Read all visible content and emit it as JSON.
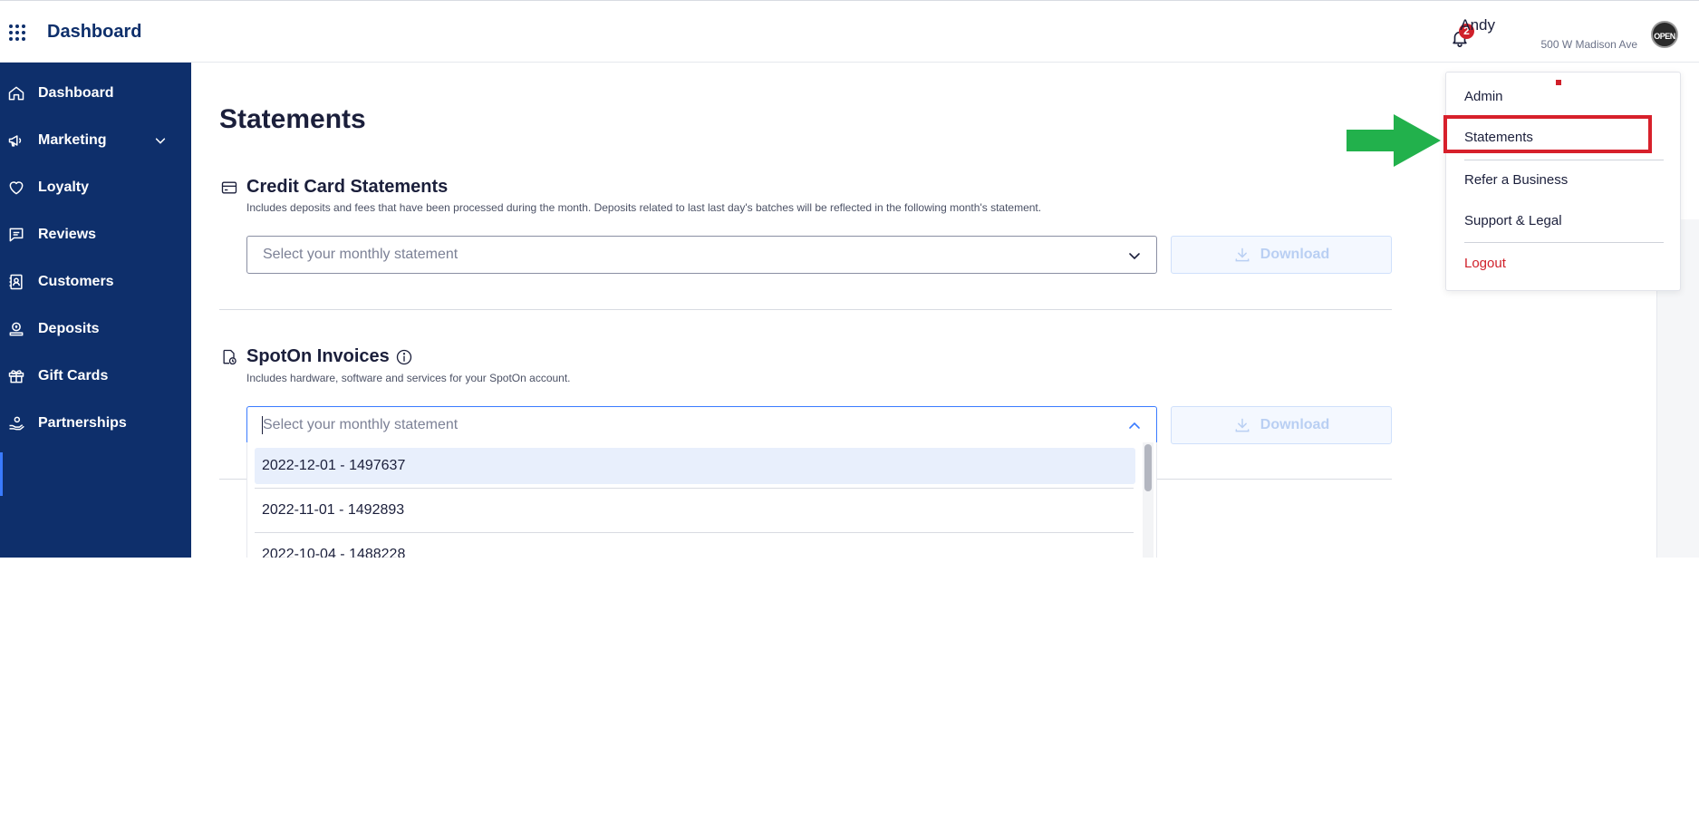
{
  "header": {
    "app_title": "Dashboard",
    "notification_count": "2",
    "user_name": "Andy",
    "user_address": "500 W Madison Ave",
    "avatar_text": "OPEN"
  },
  "sidebar": {
    "items": [
      {
        "label": "Dashboard",
        "icon": "home-icon"
      },
      {
        "label": "Marketing",
        "icon": "megaphone-icon"
      },
      {
        "label": "Loyalty",
        "icon": "heart-icon"
      },
      {
        "label": "Reviews",
        "icon": "chat-icon"
      },
      {
        "label": "Customers",
        "icon": "contact-book-icon"
      },
      {
        "label": "Deposits",
        "icon": "coin-stack-icon"
      },
      {
        "label": "Gift Cards",
        "icon": "gift-icon"
      },
      {
        "label": "Partnerships",
        "icon": "handshake-icon"
      }
    ]
  },
  "main": {
    "page_title": "Statements",
    "credit_card": {
      "title": "Credit Card Statements",
      "description": "Includes deposits and fees that have been processed during the month. Deposits related to last last day's batches will be reflected in the following month's statement.",
      "select_placeholder": "Select your monthly statement",
      "download_label": "Download"
    },
    "invoices": {
      "title": "SpotOn Invoices",
      "description": "Includes hardware, software and services for your SpotOn account.",
      "select_placeholder": "Select your monthly statement",
      "download_label": "Download",
      "options": [
        "2022-12-01 - 1497637",
        "2022-11-01 - 1492893",
        "2022-10-04 - 1488228"
      ]
    }
  },
  "user_menu": {
    "items": [
      "Admin",
      "Statements",
      "Refer a Business",
      "Support & Legal",
      "Logout"
    ]
  },
  "colors": {
    "sidebar_bg": "#0e2f6b",
    "accent": "#3a7bff",
    "danger": "#d0202a",
    "annotation_arrow": "#22b14c",
    "annotation_box": "#d7202b"
  }
}
